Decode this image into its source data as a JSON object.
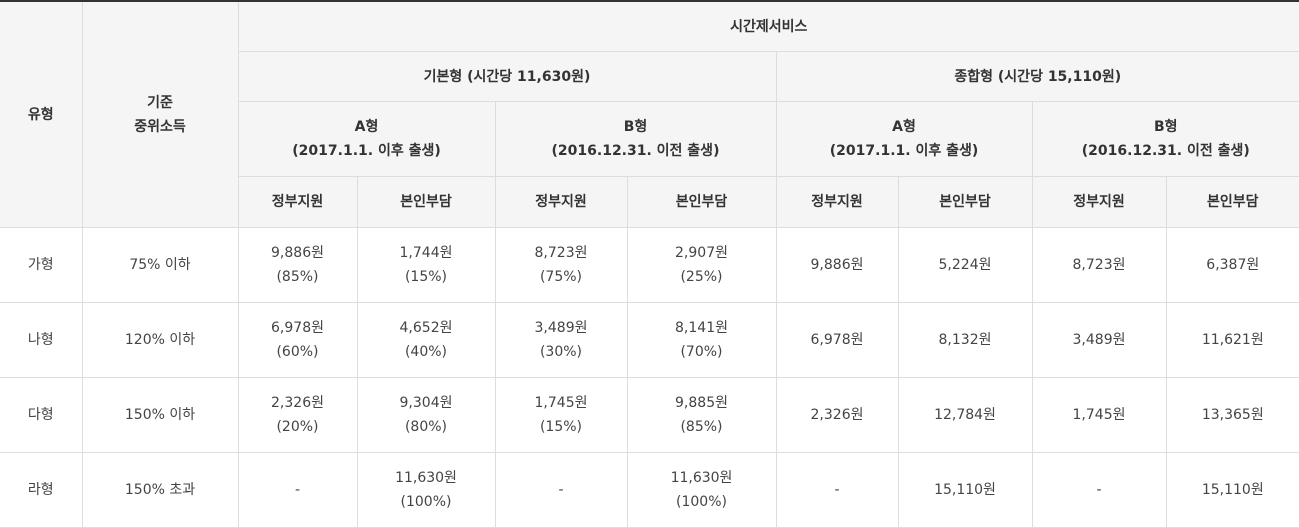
{
  "header": {
    "type_label": "유형",
    "income_label_1": "기준",
    "income_label_2": "중위소득",
    "service_label": "시간제서비스",
    "plans": [
      {
        "label": "기본형 (시간당 11,630원)"
      },
      {
        "label": "종합형 (시간당 15,110원)"
      }
    ],
    "groups": [
      {
        "name": "A형",
        "sub": "(2017.1.1. 이후 출생)"
      },
      {
        "name": "B형",
        "sub": "(2016.12.31. 이전 출생)"
      },
      {
        "name": "A형",
        "sub": "(2017.1.1. 이후 출생)"
      },
      {
        "name": "B형",
        "sub": "(2016.12.31. 이전 출생)"
      }
    ],
    "gov": "정부지원",
    "self": "본인부담"
  },
  "rows": [
    {
      "type": "가형",
      "income": "75% 이하",
      "cells": [
        {
          "amt": "9,886원",
          "pct": "(85%)"
        },
        {
          "amt": "1,744원",
          "pct": "(15%)"
        },
        {
          "amt": "8,723원",
          "pct": "(75%)"
        },
        {
          "amt": "2,907원",
          "pct": "(25%)"
        },
        {
          "amt": "9,886원",
          "pct": ""
        },
        {
          "amt": "5,224원",
          "pct": ""
        },
        {
          "amt": "8,723원",
          "pct": ""
        },
        {
          "amt": "6,387원",
          "pct": ""
        }
      ]
    },
    {
      "type": "나형",
      "income": "120% 이하",
      "cells": [
        {
          "amt": "6,978원",
          "pct": "(60%)"
        },
        {
          "amt": "4,652원",
          "pct": "(40%)"
        },
        {
          "amt": "3,489원",
          "pct": "(30%)"
        },
        {
          "amt": "8,141원",
          "pct": "(70%)"
        },
        {
          "amt": "6,978원",
          "pct": ""
        },
        {
          "amt": "8,132원",
          "pct": ""
        },
        {
          "amt": "3,489원",
          "pct": ""
        },
        {
          "amt": "11,621원",
          "pct": ""
        }
      ]
    },
    {
      "type": "다형",
      "income": "150% 이하",
      "cells": [
        {
          "amt": "2,326원",
          "pct": "(20%)"
        },
        {
          "amt": "9,304원",
          "pct": "(80%)"
        },
        {
          "amt": "1,745원",
          "pct": "(15%)"
        },
        {
          "amt": "9,885원",
          "pct": "(85%)"
        },
        {
          "amt": "2,326원",
          "pct": ""
        },
        {
          "amt": "12,784원",
          "pct": ""
        },
        {
          "amt": "1,745원",
          "pct": ""
        },
        {
          "amt": "13,365원",
          "pct": ""
        }
      ]
    },
    {
      "type": "라형",
      "income": "150% 초과",
      "cells": [
        {
          "amt": "-",
          "pct": ""
        },
        {
          "amt": "11,630원",
          "pct": "(100%)"
        },
        {
          "amt": "-",
          "pct": ""
        },
        {
          "amt": "11,630원",
          "pct": "(100%)"
        },
        {
          "amt": "-",
          "pct": ""
        },
        {
          "amt": "15,110원",
          "pct": ""
        },
        {
          "amt": "-",
          "pct": ""
        },
        {
          "amt": "15,110원",
          "pct": ""
        }
      ]
    }
  ]
}
